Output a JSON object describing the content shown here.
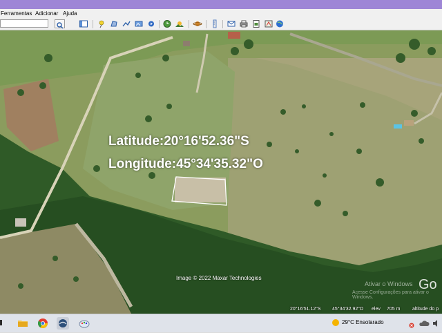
{
  "menu": {
    "items": [
      "Ferramentas",
      "Adicionar",
      "Ajuda"
    ]
  },
  "search": {
    "placeholder": ""
  },
  "overlay": {
    "latitude_label": "Latitude:20°16'52.36\"S",
    "longitude_label": "Longitude:45°34'35.32\"O"
  },
  "map": {
    "copyright": "Image © 2022 Maxar Technologies",
    "watermark_line1": "Ativar o Windows",
    "watermark_line2": "Acesse Configurações para ativar o Windows.",
    "logo_text": "Go"
  },
  "status": {
    "lat": "20°16'51.12\"S",
    "lon": "45°34'32.92\"O",
    "elev_label": "elev",
    "elev_value": "705 m",
    "eye_alt_label": "altitude do p"
  },
  "taskbar": {
    "weather_text": "29°C  Ensolarado"
  },
  "colors": {
    "titlebar": "#9e86d6",
    "polygon_outline": "#ffffff"
  }
}
